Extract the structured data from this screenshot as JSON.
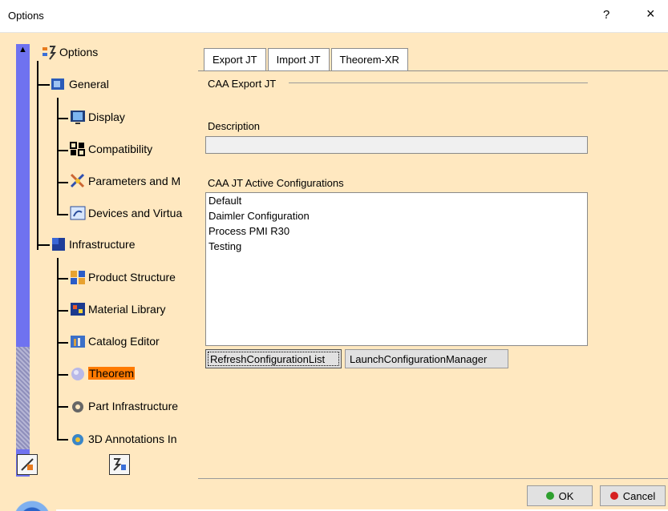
{
  "window": {
    "title": "Options",
    "help_label": "?",
    "close_label": "×"
  },
  "tree": {
    "root": "Options",
    "general": "General",
    "display": "Display",
    "compatibility": "Compatibility",
    "parameters": "Parameters and M",
    "devices": "Devices and Virtua",
    "infrastructure": "Infrastructure",
    "product_structure": "Product Structure",
    "material_library": "Material Library",
    "catalog_editor": "Catalog Editor",
    "theorem": "Theorem",
    "part_infrastructure": "Part Infrastructure",
    "annotations": "3D Annotations In"
  },
  "tabs": [
    {
      "label": "Export JT"
    },
    {
      "label": "Import JT"
    },
    {
      "label": "Theorem-XR"
    }
  ],
  "content": {
    "group_title": "CAA Export JT",
    "description_label": "Description",
    "description_value": "",
    "configs_label": "CAA JT Active Configurations",
    "configs": [
      "Default",
      "Daimler Configuration",
      "Process PMI R30",
      "Testing"
    ],
    "refresh_label": "RefreshConfigurationList",
    "launch_label": "LaunchConfigurationManager"
  },
  "footer": {
    "ok_label": "OK",
    "cancel_label": "Cancel"
  },
  "colors": {
    "background": "#ffe8c0",
    "scrollbar": "#6f72f0",
    "selection": "#ff7a00",
    "ok_dot": "#2ea02e",
    "cancel_dot": "#d62020"
  }
}
